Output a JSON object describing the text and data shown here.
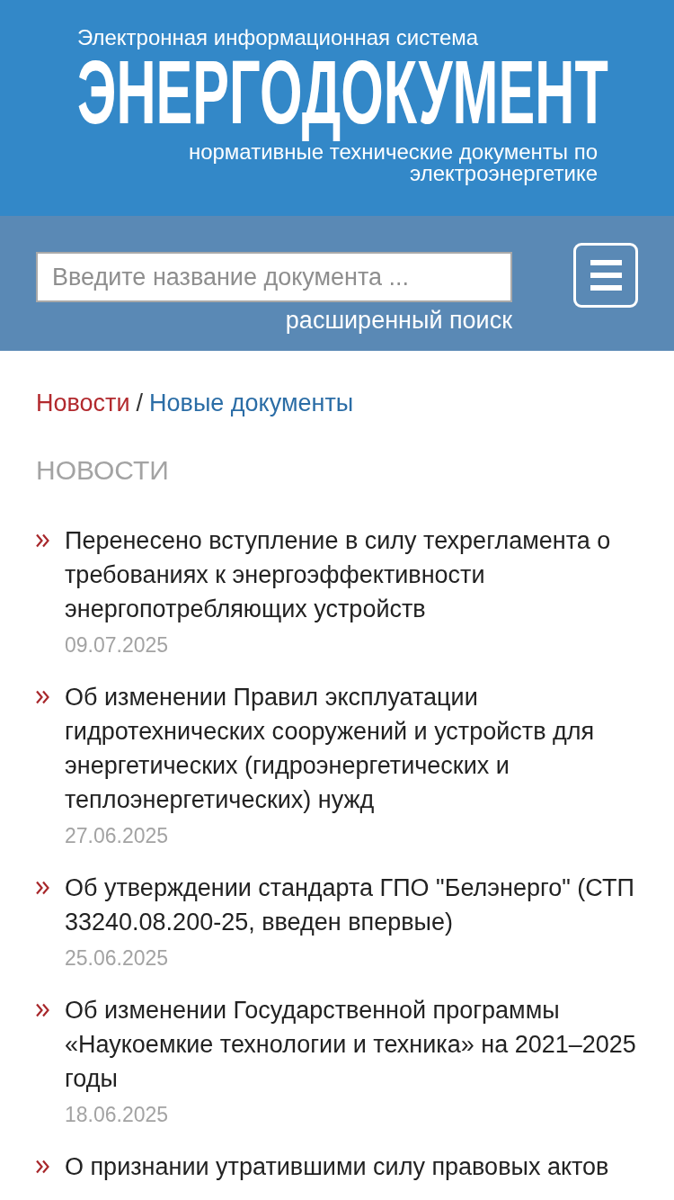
{
  "header": {
    "subtitle": "Электронная информационная система",
    "logo": "ЭНЕРГОДОКУМЕНТ",
    "tagline": "нормативные технические документы по электроэнергетике"
  },
  "search": {
    "placeholder": "Введите название документа ...",
    "advanced_link": "расширенный поиск"
  },
  "breadcrumb": {
    "separator": "/",
    "items": [
      {
        "label": "Новости",
        "color": "#b22a2e"
      },
      {
        "label": "Новые документы",
        "color": "#2b6da6"
      }
    ]
  },
  "section_title": "НОВОСТИ",
  "news": [
    {
      "title": "Перенесено вступление в силу техрегламента о требованиях к энергоэффективности энергопотребляющих устройств",
      "date": "09.07.2025"
    },
    {
      "title": "Об изменении Правил эксплуатации гидротехнических сооружений и устройств для энергетических (гидроэнергетических и теплоэнергетических) нужд",
      "date": "27.06.2025"
    },
    {
      "title": "Об утверждении стандарта ГПО \"Белэнерго\" (СТП 33240.08.200-25, введен впервые)",
      "date": "25.06.2025"
    },
    {
      "title": "Об изменении Государственной программы «Наукоемкие технологии и техника» на 2021–2025 годы",
      "date": "18.06.2025"
    },
    {
      "title": "О признании утратившими силу правовых актов"
    }
  ]
}
